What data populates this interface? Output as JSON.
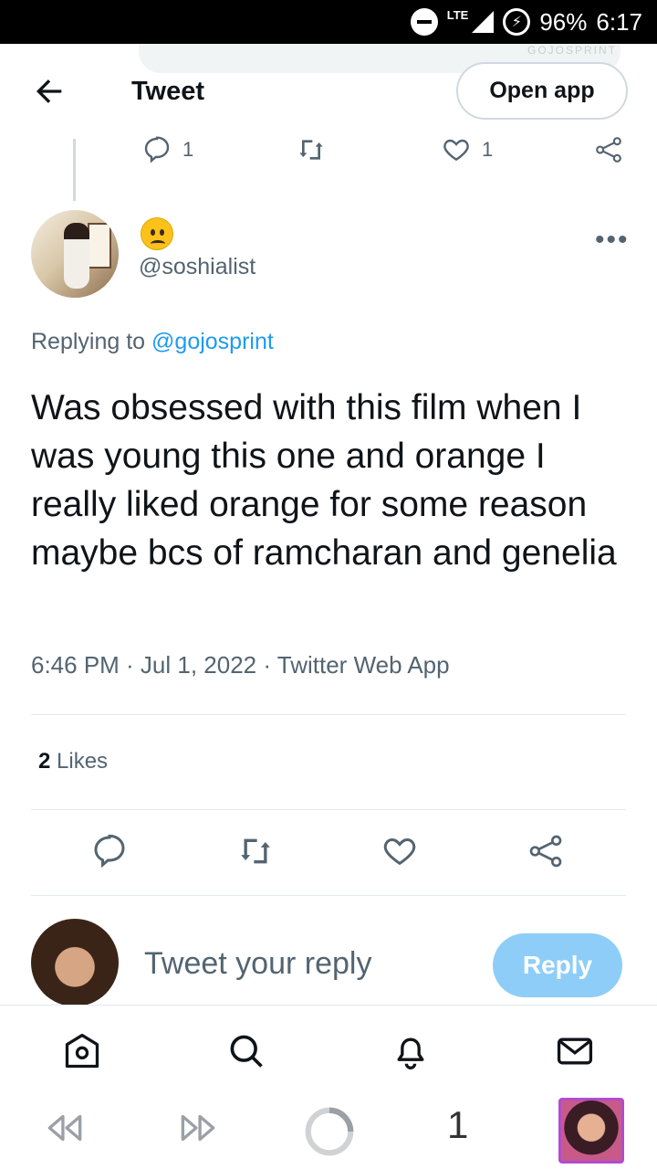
{
  "status_bar": {
    "network": "LTE",
    "battery": "96%",
    "time": "6:17"
  },
  "header": {
    "title": "Tweet",
    "open_app": "Open app",
    "watermark": "GOJOSPRINT"
  },
  "previous_tweet": {
    "reply_count": "1",
    "like_count": "1"
  },
  "tweet": {
    "handle": "@soshialist",
    "replying_prefix": "Replying to",
    "replying_to": "@gojosprint",
    "text": "Was obsessed with this film when I was young this one and orange I really liked orange for some reason maybe bcs of ramcharan and genelia",
    "meta": "6:46 PM · Jul 1, 2022 · Twitter Web App",
    "likes_count": "2",
    "likes_label": "Likes"
  },
  "composer": {
    "placeholder": "Tweet your reply",
    "reply_label": "Reply"
  },
  "browser": {
    "tab_count": "1"
  },
  "icons": [
    "back-arrow-icon",
    "reply-icon",
    "retweet-icon",
    "like-icon",
    "share-icon",
    "more-icon",
    "home-icon",
    "search-icon",
    "notifications-icon",
    "messages-icon",
    "browser-back-icon",
    "browser-forward-icon",
    "reload-icon"
  ],
  "colors": {
    "accent": "#1d9bf0",
    "reply_button": "#8ecdf8",
    "text": "#0f1419",
    "muted": "#536471"
  }
}
